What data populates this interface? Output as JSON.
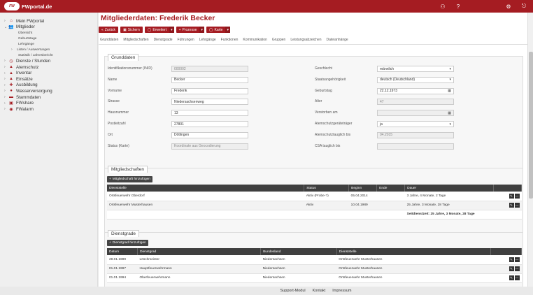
{
  "topbar": {
    "logo_badge": "FW",
    "brand": "FWportal.de",
    "icons": [
      "network-icon",
      "help-icon",
      "settings-icon",
      "logout-icon"
    ]
  },
  "sidebar": {
    "items": [
      {
        "label": "Mein FWportal",
        "icon": "house-icon",
        "caret": "›"
      },
      {
        "label": "Mitglieder",
        "icon": "users-icon",
        "caret": "⌄",
        "expanded": true
      }
    ],
    "subitems": [
      "Übersicht",
      "Geburtstage",
      "Lehrgänge"
    ],
    "sub_expand": [
      {
        "label": "Listen / Auswertungen",
        "caret": "›"
      }
    ],
    "sub_more": [
      "Statistik / Jahresbericht"
    ],
    "items2": [
      {
        "label": "Dienste / Stunden",
        "icon": "clock-icon",
        "caret": "›"
      },
      {
        "label": "Atemschutz",
        "icon": "mask-icon",
        "caret": "›"
      },
      {
        "label": "Inventar",
        "icon": "box-icon",
        "caret": "›"
      },
      {
        "label": "Einsätze",
        "icon": "alarm-icon",
        "caret": "›"
      },
      {
        "label": "Ausbildung",
        "icon": "cap-icon",
        "caret": "›"
      },
      {
        "label": "Wasserversorgung",
        "icon": "drop-icon",
        "caret": "›"
      },
      {
        "label": "Stammdaten",
        "icon": "db-icon",
        "caret": "›"
      },
      {
        "label": "FWshare",
        "icon": "share-icon",
        "caret": "›"
      },
      {
        "label": "FWalarm",
        "icon": "alert-icon",
        "caret": "›"
      }
    ]
  },
  "page": {
    "title": "Mitgliederdaten: Frederik Becker",
    "toolbar": [
      {
        "label": "Zurück",
        "icon": "«"
      },
      {
        "label": "Sichern",
        "icon": "▣"
      },
      {
        "label": "Erweitert",
        "icon": "◯",
        "dropdown": true
      },
      {
        "label": "Prozesse",
        "icon": "+",
        "dropdown": true
      },
      {
        "label": "Karte",
        "icon": "◯",
        "dropdown": true
      }
    ],
    "tabs": [
      "Grunddaten",
      "Mitgliedschaften",
      "Dienstgrade",
      "Führungen",
      "Lehrgänge",
      "Funktionen",
      "Kommunikation",
      "Gruppen",
      "Leistungsabzeichen",
      "Dateianhänge"
    ]
  },
  "grunddaten": {
    "title": "Grunddaten",
    "left": [
      {
        "label": "Identifikationsnummer (INID)",
        "value": "000002",
        "disabled": true
      },
      {
        "label": "Name",
        "value": "Becker"
      },
      {
        "label": "Vorname",
        "value": "Frederik"
      },
      {
        "label": "Strasse",
        "value": "Niedersachsenweg"
      },
      {
        "label": "Hausnummer",
        "value": "13"
      },
      {
        "label": "Postleitzahl",
        "value": "27801"
      },
      {
        "label": "Ort",
        "value": "Dötlingen"
      },
      {
        "label": "Status (Karte)",
        "value": "Koordinate aus Geocodierung",
        "disabled": true
      }
    ],
    "right": [
      {
        "label": "Geschlecht",
        "value": "männlich",
        "suffix": "▾"
      },
      {
        "label": "Staatsangehörigkeit",
        "value": "deutsch (Deutschland)",
        "suffix": "▾"
      },
      {
        "label": "Geburtstag",
        "value": "22.12.1973",
        "suffix": "▦"
      },
      {
        "label": "Alter",
        "value": "47",
        "disabled": true
      },
      {
        "label": "Verstorben am",
        "value": "",
        "suffix": "▦",
        "disabled": true
      },
      {
        "label": "Atemschutzgeräteträger",
        "value": "ja",
        "suffix": "▾"
      },
      {
        "label": "Atemschutztauglich bis",
        "value": "04.2015",
        "disabled": true
      },
      {
        "label": "CSA tauglich bis",
        "value": "",
        "disabled": true
      }
    ]
  },
  "mitgliedschaften": {
    "title": "Mitgliedschaften",
    "add_label": "Mitgliedschaft hinzufügen",
    "columns": [
      "Dienststelle",
      "Status",
      "Beginn",
      "Ende",
      "Dauer"
    ],
    "rows": [
      [
        "Ortsfeuerwehr Oberdorf",
        "Aktiv (Probe-?)",
        "05.04.2014",
        "",
        "3 Jahre, 4 Monate, 2 Tage"
      ],
      [
        "Ortsfeuerwehr Musterhausen",
        "Aktiv",
        "10.04.1989",
        "",
        "25 Jahre, 3 Monate, 28 Tage"
      ]
    ],
    "total": "Seitdienstzeit: 25 Jahre, 3 Monate, 28 Tage"
  },
  "dienstgrade": {
    "title": "Dienstgrade",
    "add_label": "Dienstgrad hinzufügen",
    "columns": [
      "Datum",
      "Dienstgrad",
      "Bundesland",
      "Dienststelle"
    ],
    "rows": [
      [
        "29.01.1999",
        "Löschmeister",
        "Niedersachsen",
        "Ortsfeuerwehr Musterhausen"
      ],
      [
        "01.01.1997",
        "Hauptfeuerwehrmann",
        "Niedersachsen",
        "Ortsfeuerwehr Musterhausen"
      ],
      [
        "01.01.1994",
        "Oberfeuerwehrmann",
        "Niedersachsen",
        "Ortsfeuerwehr Musterhausen"
      ]
    ]
  },
  "footer": [
    "Support-Modul",
    "Kontakt",
    "Impressum"
  ]
}
